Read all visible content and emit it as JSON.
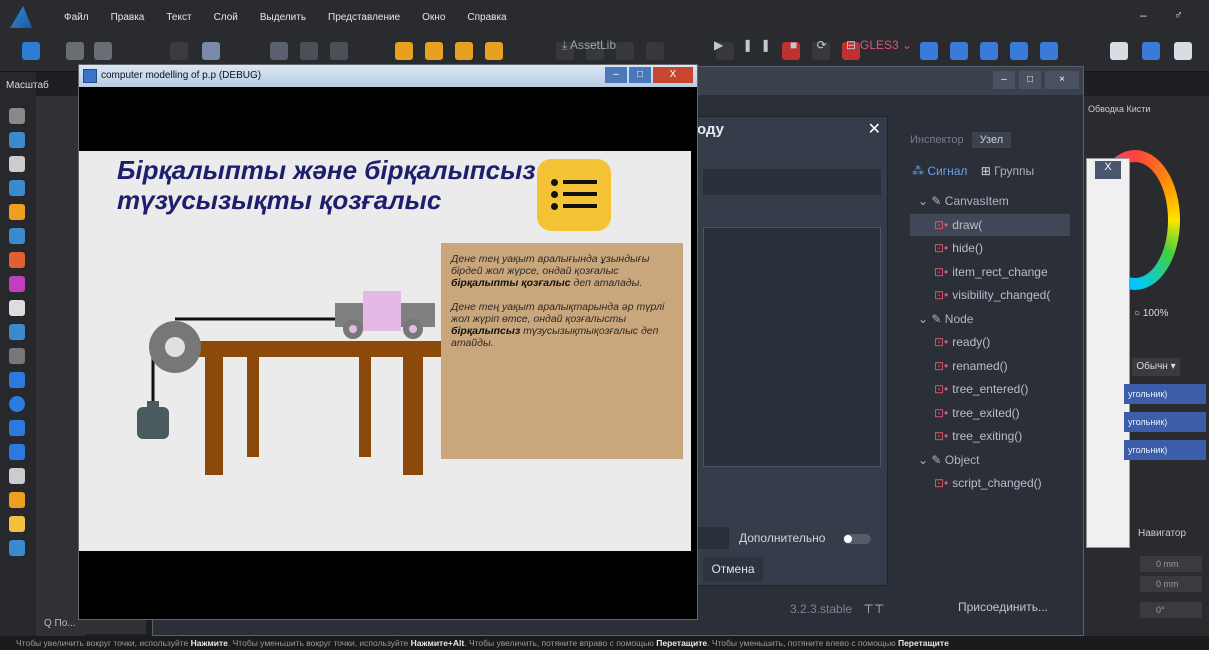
{
  "menubar": {
    "items": [
      "Файл",
      "Правка",
      "Текст",
      "Слой",
      "Выделить",
      "Представление",
      "Окно",
      "Справка"
    ],
    "window_controls": "– ♂"
  },
  "left": {
    "mashtab": "Масштаб",
    "search_placeholder": "Q По..."
  },
  "debug_window": {
    "title": "computer modelling of p.p (DEBUG)",
    "heading": "Бірқалыпты және бірқалыпсыз түзусызықты қозғалыс",
    "para1_pre": "Дене тең уақыт аралығында ұзындығы бірдей жол жүрсе, ондай қозғалыс ",
    "para1_bold": "бірқалыпты қозғалыс",
    "para1_post": " деп аталады.",
    "para2_pre": "Дене тең уақыт аралықтарында әр түрлі жол жүріп өтсе, ондай қозғалысты ",
    "para2_bold": "бірқалыпсыз",
    "para2_post": " түзусызықтықозғалыс деп атайды.",
    "btn_min": "–",
    "btn_max": "□",
    "btn_close": "X"
  },
  "godot": {
    "assetlib": "⤓ AssetLib",
    "run_controls": "▶ ❚❚ ■ ⟳ ⊟",
    "renderer": "GLES3 ⌄",
    "dialog_title": "оду",
    "dialog_close": "✕",
    "advanced": "Дополнительно",
    "cancel": "Отмена",
    "version": "3.2.3.stable",
    "version_icon": "⊤⊤",
    "inspector_tab": "Инспектор",
    "node_tab": "Узел",
    "signals_label": "Сигнал",
    "groups_label": "Группы",
    "signals": [
      {
        "text": "CanvasItem",
        "kind": "class"
      },
      {
        "text": "draw(",
        "kind": "sig",
        "selected": true
      },
      {
        "text": "hide()",
        "kind": "sig"
      },
      {
        "text": "item_rect_change",
        "kind": "sig"
      },
      {
        "text": "visibility_changed(",
        "kind": "sig"
      },
      {
        "text": "Node",
        "kind": "class"
      },
      {
        "text": "ready()",
        "kind": "sig"
      },
      {
        "text": "renamed()",
        "kind": "sig"
      },
      {
        "text": "tree_entered()",
        "kind": "sig"
      },
      {
        "text": "tree_exited()",
        "kind": "sig"
      },
      {
        "text": "tree_exiting()",
        "kind": "sig"
      },
      {
        "text": "Object",
        "kind": "class"
      },
      {
        "text": "script_changed()",
        "kind": "sig"
      }
    ],
    "connect": "Присоединить..."
  },
  "right": {
    "header": "Обводка   Кисти",
    "zoom": "100%",
    "blend": "Обычн ▾",
    "layers": [
      "угольник)",
      "угольник)",
      "угольник)"
    ],
    "navigator": "Навигатор",
    "coords": [
      "0 mm",
      "0 mm",
      "0°"
    ],
    "popup_close": "X"
  },
  "statusbar": {
    "t1": "Чтобы увеличить вокруг точки, используйте ",
    "b1": "Нажмите",
    "t2": ". Чтобы уменьшить вокруг точки, используйте ",
    "b2": "Нажмите+Alt",
    "t3": ". Чтобы увеличить, потяните вправо с помощью ",
    "b3": "Перетащите",
    "t4": ". Чтобы уменьшить, потяните влево с помощью ",
    "b4": "Перетащите"
  },
  "colors": {
    "heading": "#1e1e6e",
    "icon_bg": "#f4c235",
    "textbox_bg": "#c9a67b",
    "table": "#8b4a0c",
    "pulley": "#777777",
    "cart": "#808080",
    "cart_top": "#e6b8e8",
    "weight": "#4a5a5e",
    "godot_signal": "#e0566e"
  }
}
